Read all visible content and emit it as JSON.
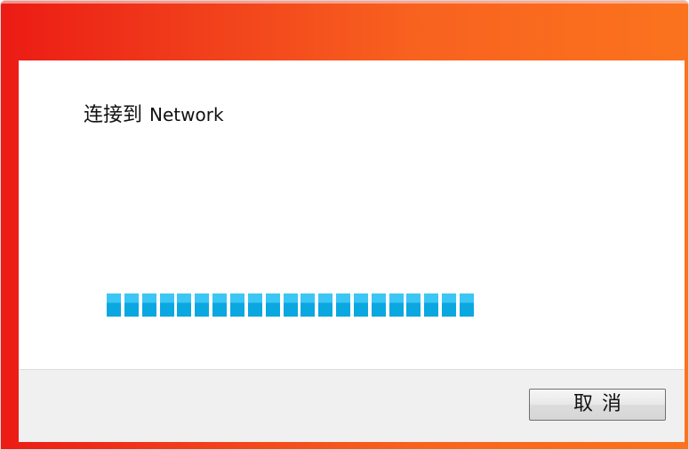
{
  "dialog": {
    "connect_prefix": "连接到",
    "network_name": "Network",
    "progress": {
      "filled_segments": 21,
      "color_top": "#3cc6f4",
      "color_bottom": "#0ba7e0"
    },
    "cancel_label": "取消"
  },
  "colors": {
    "frame_gradient_start": "#ec1b14",
    "frame_gradient_end": "#fb731e",
    "footer_bg": "#f0f0f0"
  }
}
